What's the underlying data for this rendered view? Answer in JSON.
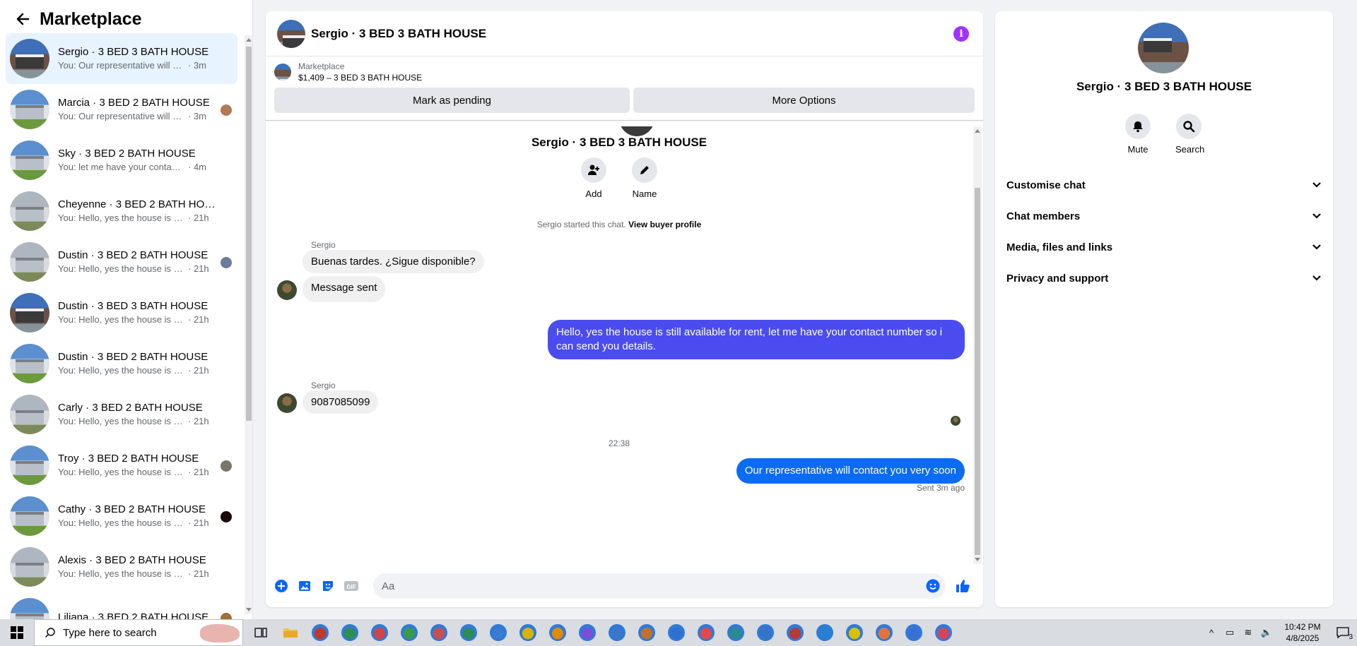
{
  "sidebar": {
    "title": "Marketplace",
    "conversations": [
      {
        "name": "Sergio · 3 BED 3 BATH HOUSE",
        "snippet": "You: Our representative will conta...",
        "time": "· 3m",
        "thumb": "dark",
        "seen": false,
        "active": true
      },
      {
        "name": "Marcia · 3 BED 2 BATH HOUSE",
        "snippet": "You: Our representative will con...",
        "time": "· 3m",
        "thumb": "house",
        "seen": true,
        "seen_color": "#b07a52"
      },
      {
        "name": "Sky · 3 BED 2 BATH HOUSE",
        "snippet": "You: let me have your contact nu...",
        "time": "· 4m",
        "thumb": "house",
        "seen": false
      },
      {
        "name": "Cheyenne · 3 BED 2 BATH HOUSE",
        "snippet": "You: Hello, yes the house is still av...",
        "time": "· 21h",
        "thumb": "gray",
        "seen": false
      },
      {
        "name": "Dustin · 3 BED 2 BATH HOUSE",
        "snippet": "You: Hello, yes the house is still...",
        "time": "· 21h",
        "thumb": "gray",
        "seen": true,
        "seen_color": "#6b7b9a"
      },
      {
        "name": "Dustin · 3 BED 3 BATH HOUSE",
        "snippet": "You: Hello, yes the house is still av...",
        "time": "· 21h",
        "thumb": "dark",
        "seen": false
      },
      {
        "name": "Dustin · 3 BED 2 BATH HOUSE",
        "snippet": "You: Hello, yes the house is still av...",
        "time": "· 21h",
        "thumb": "house",
        "seen": false
      },
      {
        "name": "Carly · 3 BED 2 BATH HOUSE",
        "snippet": "You: Hello, yes the house is still av...",
        "time": "· 21h",
        "thumb": "gray",
        "seen": false
      },
      {
        "name": "Troy · 3 BED 2 BATH HOUSE",
        "snippet": "You: Hello, yes the house is still...",
        "time": "· 21h",
        "thumb": "house",
        "seen": true,
        "seen_color": "#7d7468"
      },
      {
        "name": "Cathy · 3 BED 2 BATH HOUSE",
        "snippet": "You: Hello, yes the house is still...",
        "time": "· 21h",
        "thumb": "house",
        "seen": true,
        "seen_color": "#1a0a0a"
      },
      {
        "name": "Alexis · 3 BED 2 BATH HOUSE",
        "snippet": "You: Hello, yes the house is still...",
        "time": "· 21h",
        "thumb": "gray",
        "seen": false
      },
      {
        "name": "Liliana · 3 BED 2 BATH HOUSE",
        "snippet": "",
        "time": "",
        "thumb": "house",
        "seen": true,
        "seen_color": "#a0703a"
      }
    ]
  },
  "chat": {
    "header_name": "Sergio · 3 BED 3 BATH HOUSE",
    "info_icon": "info-icon",
    "listing_label": "Marketplace",
    "listing_title": "$1,409 – 3 BED 3 BATH HOUSE",
    "btn_pending": "Mark as pending",
    "btn_more": "More Options",
    "intro_name": "Sergio · 3 BED 3 BATH HOUSE",
    "add_label": "Add",
    "name_label": "Name",
    "started_text": "Sergio started this chat.",
    "view_profile": "View buyer profile",
    "sender_1": "Sergio",
    "msg_in_1": "Buenas tardes. ¿Sigue disponible?",
    "msg_in_2": "Message sent",
    "msg_out_1": "Hello, yes the house is still available for rent, let me have your contact number so i can send you details.",
    "sender_2": "Sergio",
    "msg_in_3": "9087085099",
    "timestamp": "22:38",
    "msg_out_2": "Our representative will contact you very soon",
    "sent_status": "Sent 3m ago",
    "composer_placeholder": "Aa",
    "colors": {
      "out_1": "#4b4cf0",
      "out_2": "#0a6cf5",
      "accent": "#0866ff"
    }
  },
  "details": {
    "name": "Sergio · 3 BED 3 BATH HOUSE",
    "mute_label": "Mute",
    "search_label": "Search",
    "menu": [
      "Customise chat",
      "Chat members",
      "Media, files and links",
      "Privacy and support"
    ]
  },
  "taskbar": {
    "search_placeholder": "Type here to search",
    "time": "10:42 PM",
    "date": "4/8/2025",
    "notif_count": "3",
    "app_colors": [
      "#c0392b",
      "#2f8f4e",
      "#d04545",
      "#3a9a4a",
      "#c94f4f",
      "#2c8c57",
      "#3b7bd0",
      "#d6b400",
      "#e08a00",
      "#7a4fd8",
      "#3d76c8",
      "#c0712c",
      "#2e6fcf",
      "#e04a4a",
      "#2a8b8b",
      "#3473c8",
      "#b53a3a",
      "#2b7fd0",
      "#d9c000",
      "#e3733c",
      "#3a6fd6",
      "#d0455a"
    ]
  }
}
